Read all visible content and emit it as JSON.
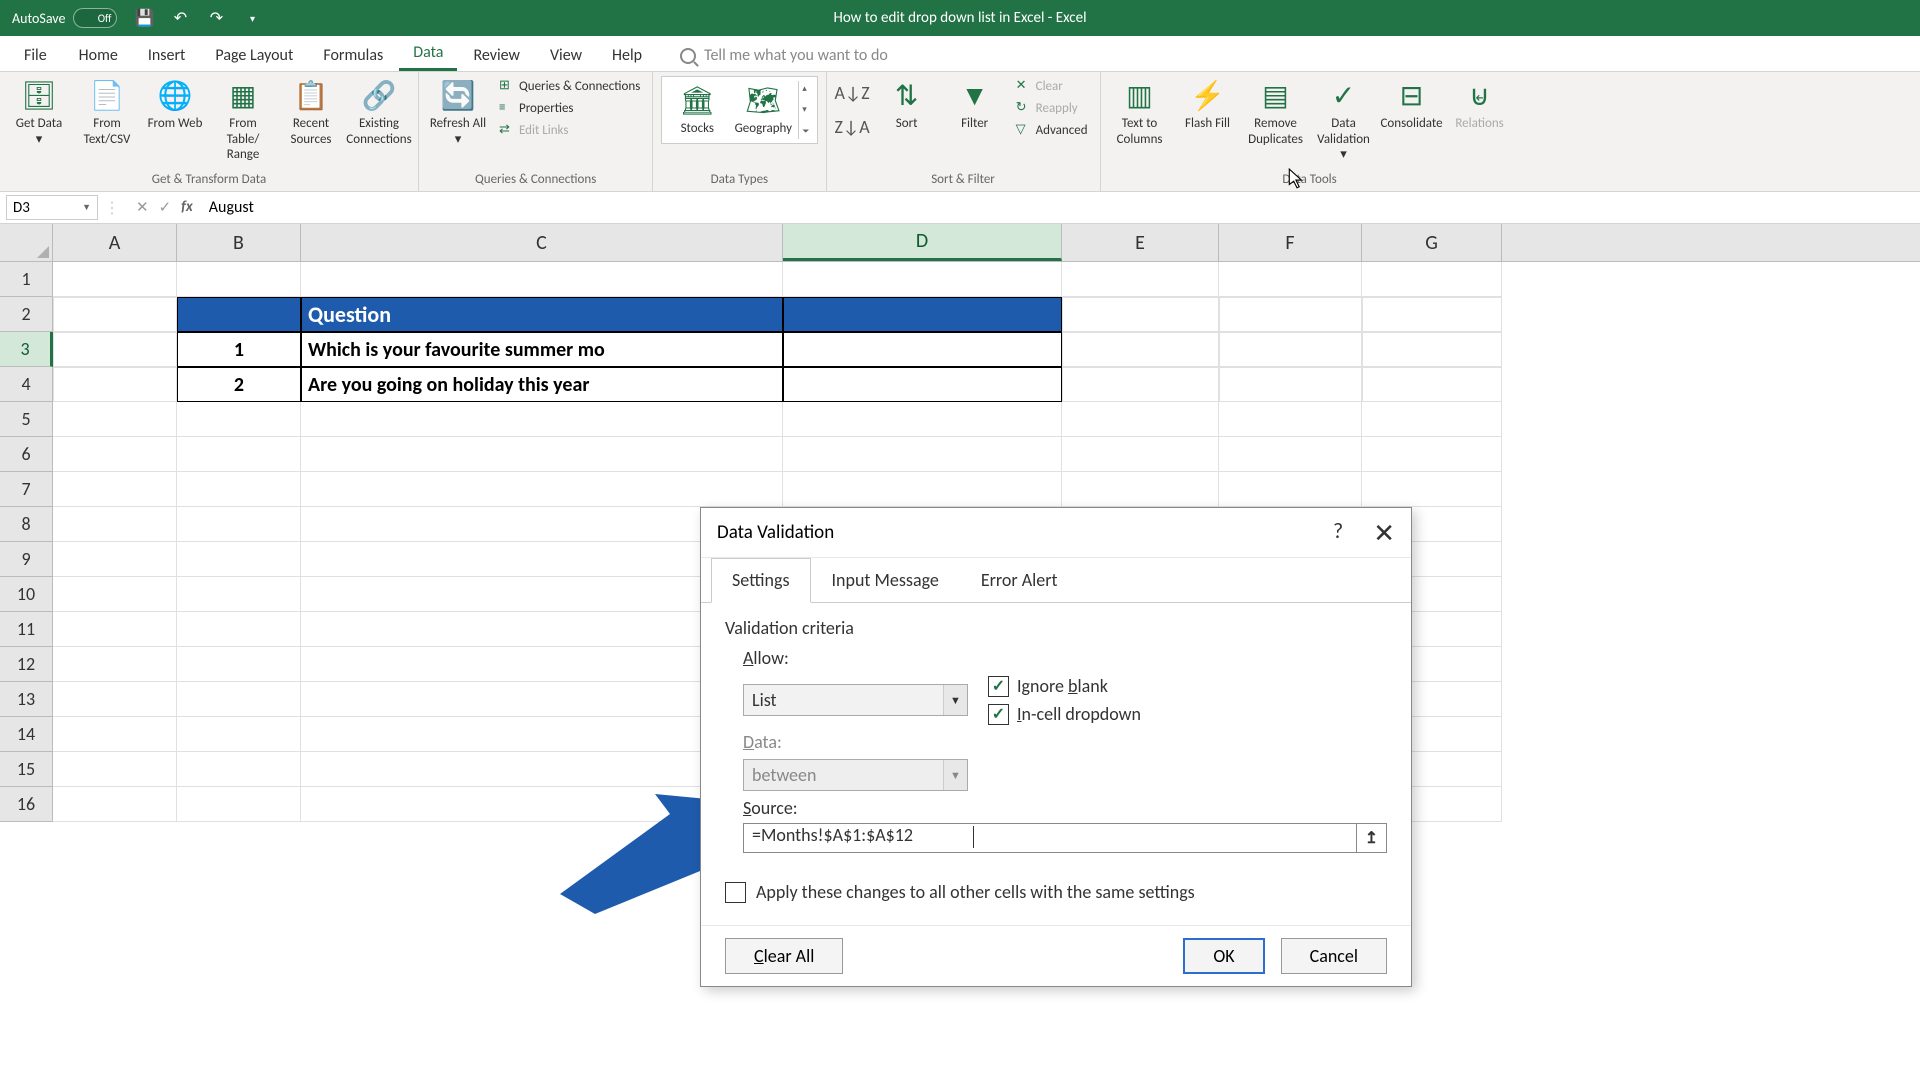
{
  "titlebar": {
    "autosave": "AutoSave",
    "autosave_state": "Off",
    "title": "How to edit drop down list in Excel  -  Excel"
  },
  "menu": {
    "file": "File",
    "home": "Home",
    "insert": "Insert",
    "page_layout": "Page Layout",
    "formulas": "Formulas",
    "data": "Data",
    "review": "Review",
    "view": "View",
    "help": "Help",
    "tellme": "Tell me what you want to do"
  },
  "ribbon": {
    "get_transform": {
      "label": "Get & Transform Data",
      "get_data": "Get Data",
      "from_textcsv": "From Text/CSV",
      "from_web": "From Web",
      "from_table": "From Table/ Range",
      "recent": "Recent Sources",
      "existing": "Existing Connections"
    },
    "queries": {
      "label": "Queries & Connections",
      "refresh": "Refresh All",
      "qc": "Queries & Connections",
      "props": "Properties",
      "edit_links": "Edit Links"
    },
    "data_types": {
      "label": "Data Types",
      "stocks": "Stocks",
      "geo": "Geography"
    },
    "sort_filter": {
      "label": "Sort & Filter",
      "sort": "Sort",
      "filter": "Filter",
      "clear": "Clear",
      "reapply": "Reapply",
      "advanced": "Advanced"
    },
    "data_tools": {
      "label": "Data Tools",
      "txt_cols": "Text to Columns",
      "flash": "Flash Fill",
      "dup": "Remove Duplicates",
      "validation": "Data Validation",
      "consolidate": "Consolidate",
      "relations": "Relations"
    }
  },
  "formula_bar": {
    "name": "D3",
    "value": "August"
  },
  "grid": {
    "cols": [
      "A",
      "B",
      "C",
      "D",
      "E",
      "F",
      "G"
    ],
    "rows": [
      "1",
      "2",
      "3",
      "4",
      "5",
      "6",
      "7",
      "8",
      "9",
      "10",
      "11",
      "12",
      "13",
      "14",
      "15",
      "16"
    ],
    "header": {
      "q": "Question"
    },
    "r3": {
      "num": "1",
      "q": "Which is your favourite summer mo"
    },
    "r4": {
      "num": "2",
      "q": "Are you going on holiday this year"
    }
  },
  "dialog": {
    "title": "Data Validation",
    "tabs": {
      "settings": "Settings",
      "input": "Input Message",
      "error": "Error Alert"
    },
    "criteria": "Validation criteria",
    "allow_lbl": "Allow:",
    "allow_val": "List",
    "data_lbl": "Data:",
    "data_val": "between",
    "source_lbl": "Source:",
    "source_val": "=Months!$A$1:$A$12",
    "ignore_blank": "Ignore blank",
    "incell": "In-cell dropdown",
    "apply": "Apply these changes to all other cells with the same settings",
    "clear": "Clear All",
    "ok": "OK",
    "cancel": "Cancel"
  }
}
